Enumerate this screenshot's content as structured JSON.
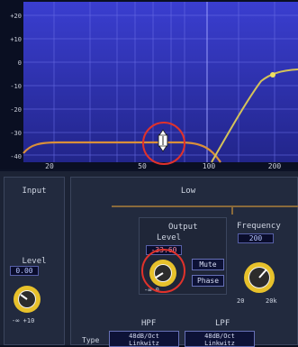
{
  "graph": {
    "y_ticks": [
      "+20",
      "+10",
      "0",
      "-10",
      "-20",
      "-30",
      "-40"
    ],
    "x_ticks": [
      "20",
      "50",
      "100",
      "200"
    ]
  },
  "input": {
    "title": "Input",
    "level_label": "Level",
    "level_value": "0.00",
    "scale": "-∞  +10"
  },
  "band": {
    "title": "Low",
    "output_title": "Output",
    "level_label": "Level",
    "level_value": "-33.60",
    "mute_label": "Mute",
    "phase_label": "Phase",
    "level_scale": "-∞ 0",
    "frequency_title": "Frequency",
    "frequency_value": "200",
    "freq_scale_low": "20",
    "freq_scale_high": "20k",
    "hpf_label": "HPF",
    "lpf_label": "LPF",
    "type_label": "Type",
    "hpf_type_line1": "48dB/Oct",
    "hpf_type_line2": "Linkwitz",
    "lpf_type_line1": "48dB/Oct",
    "lpf_type_line2": "Linkwitz"
  },
  "colors": {
    "graph_bg": "#2a2fa0",
    "curve": "#d98f3a",
    "curve_alt": "#d4c25a",
    "annotation": "#e0322b"
  }
}
